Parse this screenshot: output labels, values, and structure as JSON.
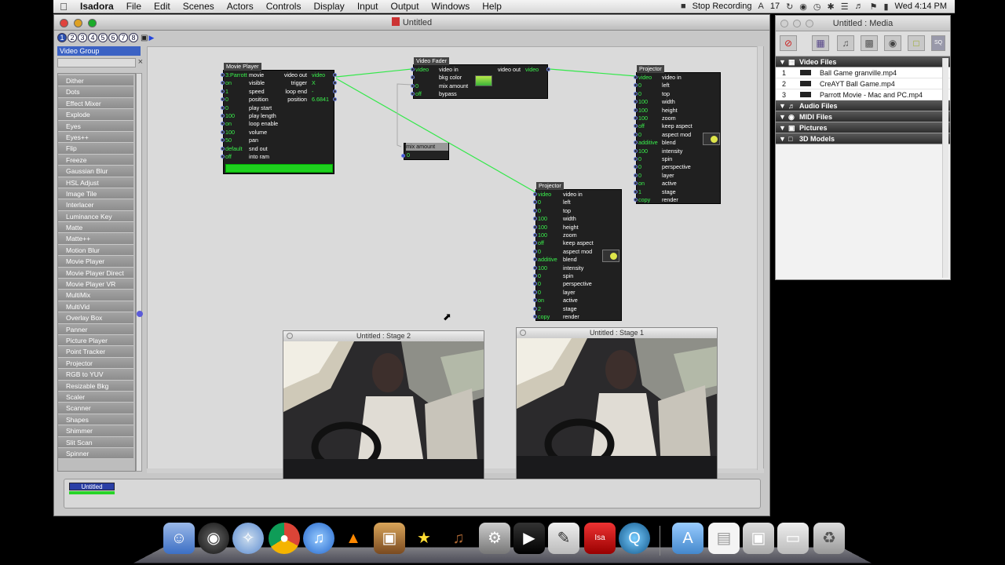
{
  "menubar": {
    "app": "Isadora",
    "items": [
      "File",
      "Edit",
      "Scenes",
      "Actors",
      "Controls",
      "Display",
      "Input",
      "Output",
      "Windows",
      "Help"
    ],
    "stop_recording": "Stop Recording",
    "a17": "17",
    "clock": "Wed 4:14 PM"
  },
  "main_window": {
    "title": "Untitled",
    "scenes": [
      "1",
      "2",
      "3",
      "4",
      "5",
      "6",
      "7",
      "8"
    ]
  },
  "sidebar": {
    "group": "Video Group",
    "search_placeholder": "",
    "items": [
      "Dither",
      "Dots",
      "Effect Mixer",
      "Explode",
      "Eyes",
      "Eyes++",
      "Flip",
      "Freeze",
      "Gaussian Blur",
      "HSL Adjust",
      "Image Tile",
      "Interlacer",
      "Luminance Key",
      "Matte",
      "Matte++",
      "Motion Blur",
      "Movie Player",
      "Movie Player Direct",
      "Movie Player VR",
      "MultiMix",
      "MultiVid",
      "Overlay Box",
      "Panner",
      "Picture Player",
      "Point Tracker",
      "Projector",
      "RGB to YUV",
      "Resizable Bkg",
      "Scaler",
      "Scanner",
      "Shapes",
      "Shimmer",
      "Slit Scan",
      "Spinner"
    ]
  },
  "actors": {
    "movie_player": {
      "title": "Movie Player",
      "inputs": [
        {
          "v": "3:Parrott",
          "l": "movie"
        },
        {
          "v": "on",
          "l": "visible"
        },
        {
          "v": "1",
          "l": "speed"
        },
        {
          "v": "0",
          "l": "position"
        },
        {
          "v": "0",
          "l": "play start"
        },
        {
          "v": "100",
          "l": "play length"
        },
        {
          "v": "on",
          "l": "loop enable"
        },
        {
          "v": "100",
          "l": "volume"
        },
        {
          "v": "50",
          "l": "pan"
        },
        {
          "v": "default",
          "l": "snd out"
        },
        {
          "v": "off",
          "l": "into ram"
        }
      ],
      "outputs": [
        {
          "l": "video out",
          "v": "video"
        },
        {
          "l": "trigger",
          "v": "X"
        },
        {
          "l": "loop end",
          "v": "-"
        },
        {
          "l": "position",
          "v": "6.6841"
        }
      ]
    },
    "video_fader": {
      "title": "Video Fader",
      "inputs": [
        {
          "v": "video",
          "l": "video in"
        },
        {
          "v": "",
          "l": "bkg color"
        },
        {
          "v": "0",
          "l": "mix amount"
        },
        {
          "v": "off",
          "l": "bypass"
        }
      ],
      "outputs": [
        {
          "l": "video out",
          "v": "video"
        }
      ]
    },
    "mix_amount": {
      "title": "mix amount",
      "value": "0"
    },
    "projector_a": {
      "title": "Projector",
      "inputs": [
        {
          "v": "video",
          "l": "video in"
        },
        {
          "v": "0",
          "l": "left"
        },
        {
          "v": "0",
          "l": "top"
        },
        {
          "v": "100",
          "l": "width"
        },
        {
          "v": "100",
          "l": "height"
        },
        {
          "v": "100",
          "l": "zoom"
        },
        {
          "v": "off",
          "l": "keep aspect"
        },
        {
          "v": "0",
          "l": "aspect mod"
        },
        {
          "v": "additive",
          "l": "blend"
        },
        {
          "v": "100",
          "l": "intensity"
        },
        {
          "v": "0",
          "l": "spin"
        },
        {
          "v": "0",
          "l": "perspective"
        },
        {
          "v": "0",
          "l": "layer"
        },
        {
          "v": "on",
          "l": "active"
        },
        {
          "v": "1",
          "l": "stage"
        },
        {
          "v": "copy",
          "l": "render"
        }
      ]
    },
    "projector_b": {
      "title": "Projector",
      "inputs": [
        {
          "v": "video",
          "l": "video in"
        },
        {
          "v": "0",
          "l": "left"
        },
        {
          "v": "0",
          "l": "top"
        },
        {
          "v": "100",
          "l": "width"
        },
        {
          "v": "100",
          "l": "height"
        },
        {
          "v": "100",
          "l": "zoom"
        },
        {
          "v": "off",
          "l": "keep aspect"
        },
        {
          "v": "0",
          "l": "aspect mod"
        },
        {
          "v": "additive",
          "l": "blend"
        },
        {
          "v": "100",
          "l": "intensity"
        },
        {
          "v": "0",
          "l": "spin"
        },
        {
          "v": "0",
          "l": "perspective"
        },
        {
          "v": "0",
          "l": "layer"
        },
        {
          "v": "on",
          "l": "active"
        },
        {
          "v": "2",
          "l": "stage"
        },
        {
          "v": "copy",
          "l": "render"
        }
      ]
    }
  },
  "stages": {
    "stage2": "Untitled : Stage 2",
    "stage1": "Untitled : Stage 1"
  },
  "scene_strip": {
    "scene": "Untitled"
  },
  "media": {
    "title": "Untitled : Media",
    "sections": [
      "Video Files",
      "Audio Files",
      "MIDI Files",
      "Pictures",
      "3D Models"
    ],
    "videos": [
      {
        "n": "1",
        "name": "Ball Game granville.mp4"
      },
      {
        "n": "2",
        "name": "CreAYT Ball Game.mp4"
      },
      {
        "n": "3",
        "name": "Parrott Movie - Mac and PC.mp4"
      }
    ]
  },
  "colors": {
    "wire": "#33e84a",
    "value": "#3af24d",
    "selection": "#3b62c4"
  }
}
